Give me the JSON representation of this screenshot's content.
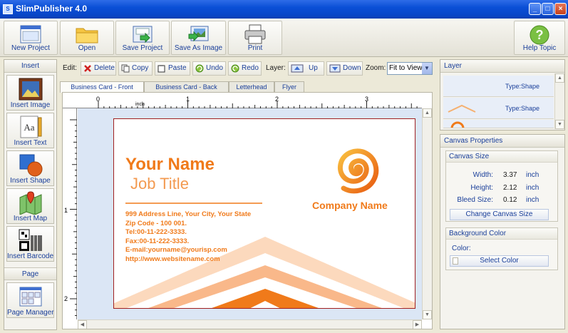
{
  "window": {
    "title": "SlimPublisher 4.0",
    "icon": "S"
  },
  "toolbar": {
    "new_project": "New Project",
    "open": "Open",
    "save_project": "Save Project",
    "save_as_image": "Save As Image",
    "print": "Print",
    "help_topic": "Help Topic"
  },
  "left_panel": {
    "insert_header": "Insert",
    "insert_image": "Insert Image",
    "insert_text": "Insert Text",
    "insert_shape": "Insert Shape",
    "insert_map": "Insert Map",
    "insert_barcode": "Insert Barcode",
    "page_header": "Page",
    "page_manager": "Page Manager"
  },
  "edit_bar": {
    "edit_label": "Edit:",
    "delete": "Delete",
    "copy": "Copy",
    "paste": "Paste",
    "undo": "Undo",
    "redo": "Redo",
    "layer_label": "Layer:",
    "up": "Up",
    "down": "Down",
    "zoom_label": "Zoom:",
    "zoom_value": "Fit to View"
  },
  "tabs": [
    {
      "label": "Business Card - Front",
      "active": true
    },
    {
      "label": "Business Card - Back",
      "active": false
    },
    {
      "label": "Letterhead",
      "active": false
    },
    {
      "label": "Flyer",
      "active": false
    }
  ],
  "ruler": {
    "unit": "inch",
    "h_labels": [
      "0",
      "1",
      "2",
      "3"
    ],
    "v_labels": [
      "1",
      "2"
    ]
  },
  "card": {
    "name": "Your Name",
    "job_title": "Job Title",
    "address": "999 Address Line, Your City, Your State",
    "zip": "Zip Code - 100 001.",
    "tel": "Tel:00-11-222-3333.",
    "fax": "Fax:00-11-222-3333.",
    "email": "E-mail:yourname@yourisp.com",
    "web": "http://www.websitename.com",
    "company": "Company Name",
    "accent_color": "#f07a1a"
  },
  "layer_panel": {
    "title": "Layer",
    "items": [
      "Type:Shape",
      "Type:Shape"
    ]
  },
  "canvas_properties": {
    "title": "Canvas Properties",
    "size_header": "Canvas Size",
    "width_label": "Width:",
    "width_value": "3.37",
    "height_label": "Height:",
    "height_value": "2.12",
    "bleed_label": "Bleed Size:",
    "bleed_value": "0.12",
    "unit": "inch",
    "change_size_button": "Change Canvas Size",
    "bg_header": "Background Color",
    "color_label": "Color:",
    "select_color_button": "Select Color"
  }
}
